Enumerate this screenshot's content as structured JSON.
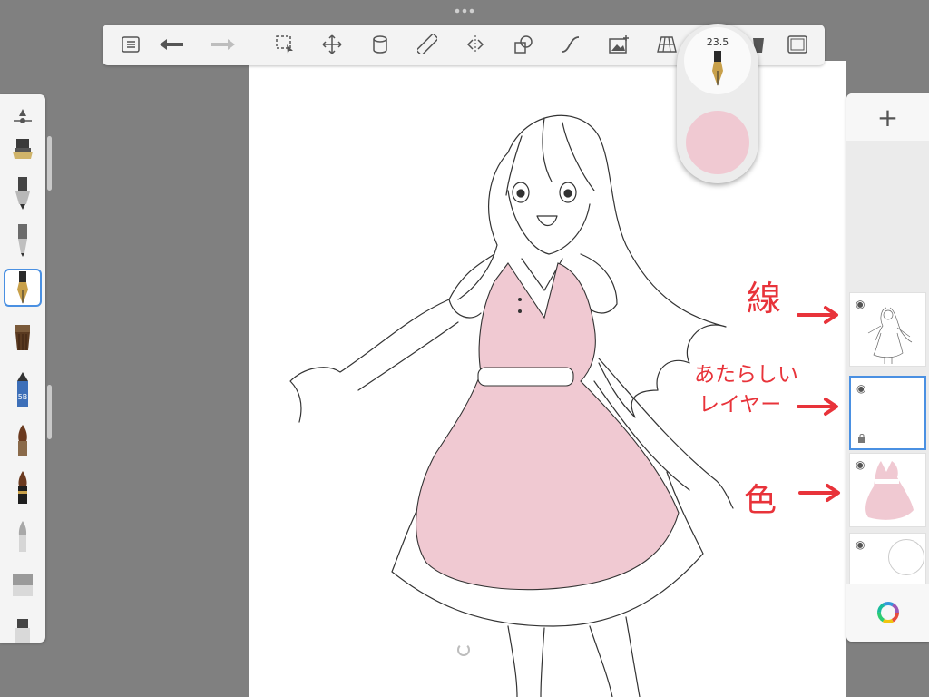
{
  "toolbar": {
    "items": [
      "menu-icon",
      "undo-icon",
      "redo-icon",
      "selection-icon",
      "transform-icon",
      "fill-icon",
      "ruler-icon",
      "symmetry-icon",
      "shapes-icon",
      "curve-icon",
      "add-image-icon",
      "perspective-icon",
      "bucket-icon",
      "fullscreen-icon"
    ]
  },
  "brush_puck": {
    "size": "23.5",
    "color": "#f0c9d2"
  },
  "brushes": [
    "brush-settings-icon",
    "airbrush-icon",
    "marker-icon",
    "pencil-tip-icon",
    "ink-pen-icon",
    "paint-brush-icon",
    "pencil-5b-icon",
    "round-brush-icon",
    "calligraphy-brush-icon",
    "soft-brush-icon",
    "eraser-icon",
    "smudge-icon"
  ],
  "brush_labels": {
    "pencil": "5B"
  },
  "layers": {
    "add_label": "+",
    "items": [
      {
        "name": "line-layer",
        "selected": false
      },
      {
        "name": "new-layer",
        "selected": true
      },
      {
        "name": "color-layer",
        "selected": false
      },
      {
        "name": "background-layer",
        "selected": false
      }
    ]
  },
  "annotations": {
    "line": "線",
    "new_layer_1": "あたらしい",
    "new_layer_2": "レイヤー",
    "color": "色"
  },
  "colors": {
    "accent": "#4a90e2",
    "annotation": "#e8333a",
    "dress": "#f0c9d2"
  }
}
